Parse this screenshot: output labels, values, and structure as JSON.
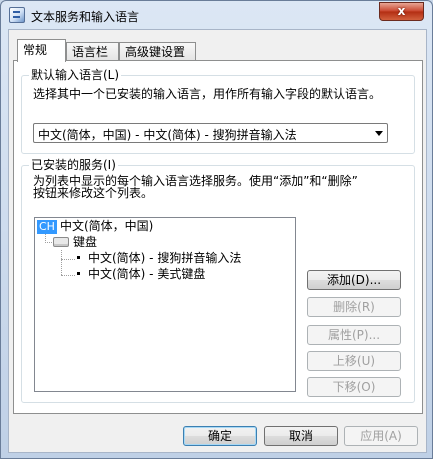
{
  "window": {
    "title": "文本服务和输入语言",
    "close_label": "x"
  },
  "tabs": [
    {
      "label": "常规"
    },
    {
      "label": "语言栏"
    },
    {
      "label": "高级键设置"
    }
  ],
  "default_language": {
    "group_label": "默认输入语言(L)",
    "description": "选择其中一个已安装的输入语言，用作所有输入字段的默认语言。",
    "selected": "中文(简体，中国) - 中文(简体) - 搜狗拼音输入法"
  },
  "installed_services": {
    "group_label": "已安装的服务(I)",
    "description_line1": "为列表中显示的每个输入语言选择服务。使用“添加”和“删除”",
    "description_line2": "按钮来修改这个列表。",
    "tree": {
      "language_badge": "CH",
      "language": "中文(简体，中国)",
      "category": "键盘",
      "items": [
        "中文(简体) - 搜狗拼音输入法",
        "中文(简体) - 美式键盘"
      ]
    },
    "buttons": {
      "add": "添加(D)...",
      "remove": "删除(R)",
      "properties": "属性(P)...",
      "move_up": "上移(U)",
      "move_down": "下移(O)"
    }
  },
  "footer": {
    "ok": "确定",
    "cancel": "取消",
    "apply": "应用(A)"
  }
}
